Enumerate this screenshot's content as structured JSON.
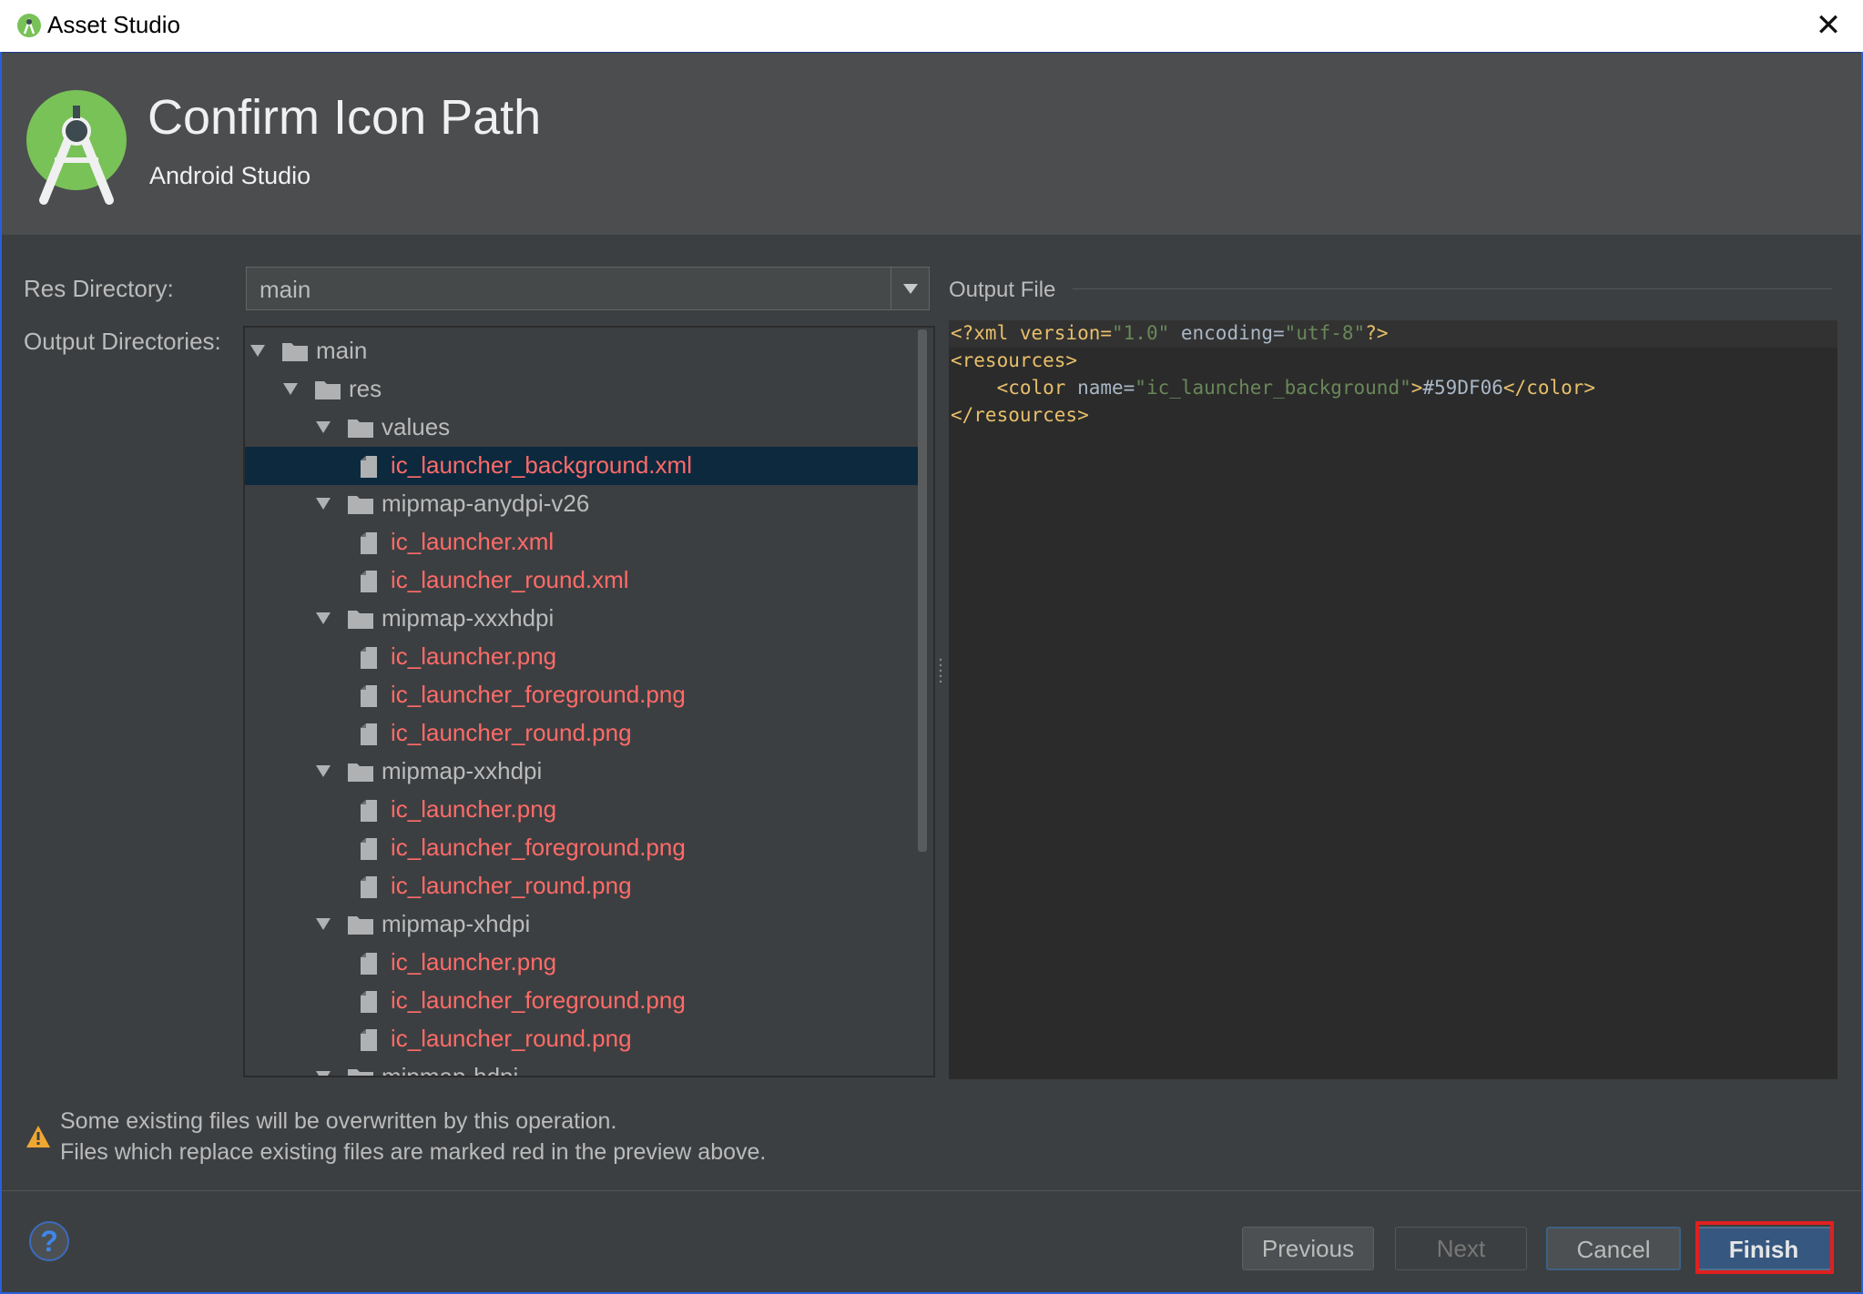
{
  "window": {
    "title": "Asset Studio",
    "close_icon": "close-icon"
  },
  "header": {
    "title": "Confirm Icon Path",
    "subtitle": "Android Studio",
    "logo_icon": "android-studio-logo-icon"
  },
  "form": {
    "res_directory_label": "Res Directory:",
    "res_directory_value": "main",
    "output_directories_label": "Output Directories:",
    "output_file_label": "Output File"
  },
  "tree": [
    {
      "type": "folder",
      "level": 0,
      "label": "main",
      "expanded": true
    },
    {
      "type": "folder",
      "level": 1,
      "label": "res",
      "expanded": true
    },
    {
      "type": "folder",
      "level": 2,
      "label": "values",
      "expanded": true
    },
    {
      "type": "file",
      "level": 3,
      "label": "ic_launcher_background.xml",
      "selected": true
    },
    {
      "type": "folder",
      "level": 2,
      "label": "mipmap-anydpi-v26",
      "expanded": true
    },
    {
      "type": "file",
      "level": 3,
      "label": "ic_launcher.xml"
    },
    {
      "type": "file",
      "level": 3,
      "label": "ic_launcher_round.xml"
    },
    {
      "type": "folder",
      "level": 2,
      "label": "mipmap-xxxhdpi",
      "expanded": true
    },
    {
      "type": "file",
      "level": 3,
      "label": "ic_launcher.png"
    },
    {
      "type": "file",
      "level": 3,
      "label": "ic_launcher_foreground.png"
    },
    {
      "type": "file",
      "level": 3,
      "label": "ic_launcher_round.png"
    },
    {
      "type": "folder",
      "level": 2,
      "label": "mipmap-xxhdpi",
      "expanded": true
    },
    {
      "type": "file",
      "level": 3,
      "label": "ic_launcher.png"
    },
    {
      "type": "file",
      "level": 3,
      "label": "ic_launcher_foreground.png"
    },
    {
      "type": "file",
      "level": 3,
      "label": "ic_launcher_round.png"
    },
    {
      "type": "folder",
      "level": 2,
      "label": "mipmap-xhdpi",
      "expanded": true
    },
    {
      "type": "file",
      "level": 3,
      "label": "ic_launcher.png"
    },
    {
      "type": "file",
      "level": 3,
      "label": "ic_launcher_foreground.png"
    },
    {
      "type": "file",
      "level": 3,
      "label": "ic_launcher_round.png"
    },
    {
      "type": "folder",
      "level": 2,
      "label": "mipmap-hdpi",
      "expanded": true
    }
  ],
  "code": {
    "line1": {
      "p1": "<?xml version=",
      "v1": "\"1.0\"",
      "p2": " encoding=",
      "v2": "\"utf-8\"",
      "p3": "?>"
    },
    "line2": "<resources>",
    "line3": {
      "indent": "    ",
      "open": "<color",
      "attr": " name=",
      "val": "\"ic_launcher_background\"",
      "close": ">",
      "text": "#59DF06",
      "end": "</color>"
    },
    "line4": "</resources>"
  },
  "warning": {
    "icon": "warning-icon",
    "line1": "Some existing files will be overwritten by this operation.",
    "line2": "Files which replace existing files are marked red in the preview above."
  },
  "buttons": {
    "help": "?",
    "previous": "Previous",
    "next": "Next",
    "cancel": "Cancel",
    "finish": "Finish"
  },
  "colors": {
    "overwritten_file": "#ff6b68",
    "selection": "#0d293e",
    "logo_green": "#78c257"
  }
}
